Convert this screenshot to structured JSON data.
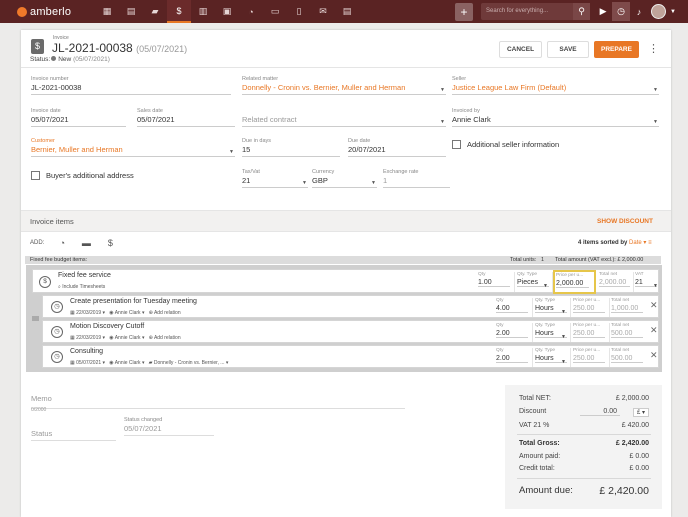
{
  "topbar": {
    "brand": "amberlo",
    "nav_icons": [
      "dashboard-icon",
      "contacts-icon",
      "matters-icon",
      "invoices-icon",
      "bank-icon",
      "calendar-icon",
      "time-icon",
      "folder-icon",
      "documents-icon",
      "mail-icon",
      "reports-icon"
    ],
    "search_placeholder": "Search for everything..."
  },
  "invoice": {
    "kind": "Invoice",
    "number": "JL-2021-00038",
    "date_paren": "(05/07/2021)",
    "status_label": "Status:",
    "status": "New",
    "status_date": "(05/07/2021)"
  },
  "actions": {
    "cancel": "CANCEL",
    "save": "SAVE",
    "prepare": "PREPARE"
  },
  "fields": {
    "invoice_number": {
      "label": "Invoice number",
      "value": "JL-2021-00038"
    },
    "related_matter": {
      "label": "Related matter",
      "value": "Donnelly - Cronin vs. Bernier, Muller and Herman"
    },
    "seller": {
      "label": "Seller",
      "value": "Justice League Law Firm (Default)"
    },
    "invoice_date": {
      "label": "Invoice date",
      "value": "05/07/2021"
    },
    "sales_date": {
      "label": "Sales date",
      "value": "05/07/2021"
    },
    "related_contract": {
      "label": "Related contract"
    },
    "invoiced_by": {
      "label": "Invoiced by",
      "value": "Annie Clark"
    },
    "customer": {
      "label": "Customer",
      "value": "Bernier, Muller and Herman"
    },
    "due_in_days": {
      "label": "Due in days",
      "value": "15"
    },
    "due_date": {
      "label": "Due date",
      "value": "20/07/2021"
    },
    "additional_seller": "Additional seller information",
    "buyer_address": "Buyer's additional address",
    "tax_vat": {
      "label": "Tax/Vat",
      "value": "21"
    },
    "currency": {
      "label": "Currency",
      "value": "GBP"
    },
    "exchange_rate": {
      "label": "Exchange rate",
      "value": "1"
    }
  },
  "items": {
    "title": "Invoice items",
    "show_discount": "SHOW DISCOUNT",
    "add_label": "ADD:",
    "count_text": "4 items sorted by",
    "sort_field": "Date",
    "budget_label": "Fixed fee budget items:",
    "total_units_label": "Total units:",
    "total_units": "1",
    "total_amount": "Total amount (VAT excl.): £ 2,000.00",
    "cols": {
      "qty": "Qty",
      "qty_type": "Qty. Type",
      "price": "Price per u...",
      "total_net": "Total net",
      "vat": "VAT"
    },
    "parent": {
      "name": "Fixed fee service",
      "sub": "Include Timesheets",
      "qty": "1.00",
      "qty_type": "Pieces",
      "price": "2,000.00",
      "total_net": "2,000.00",
      "vat": "21"
    },
    "children": [
      {
        "name": "Create presentation for Tuesday meeting",
        "date": "22/03/2019",
        "user": "Annie Clark",
        "extra": "Add relation",
        "qty": "4.00",
        "qty_type": "Hours",
        "price": "250.00",
        "total_net": "1,000.00"
      },
      {
        "name": "Motion Discovery Cutoff",
        "date": "22/03/2019",
        "user": "Annie Clark",
        "extra": "Add relation",
        "qty": "2.00",
        "qty_type": "Hours",
        "price": "250.00",
        "total_net": "500.00"
      },
      {
        "name": "Consulting",
        "date": "05/07/2021",
        "user": "Annie Clark",
        "extra": "Donnelly - Cronin vs. Bernier, ...",
        "qty": "2.00",
        "qty_type": "Hours",
        "price": "250.00",
        "total_net": "500.00"
      }
    ]
  },
  "memo": {
    "label": "Memo",
    "count": "0/2000"
  },
  "footer_status": {
    "label": "Status",
    "changed_label": "Status changed",
    "changed_value": "05/07/2021"
  },
  "summary": {
    "total_net_label": "Total NET:",
    "total_net": "£ 2,000.00",
    "discount_label": "Discount",
    "discount_value": "0.00",
    "discount_unit": "£",
    "vat_label": "VAT 21 %",
    "vat": "£ 420.00",
    "gross_label": "Total Gross:",
    "gross": "£ 2,420.00",
    "paid_label": "Amount paid:",
    "paid": "£ 0.00",
    "credit_label": "Credit total:",
    "credit": "£ 0.00",
    "due_label": "Amount due:",
    "due": "£ 2,420.00"
  }
}
